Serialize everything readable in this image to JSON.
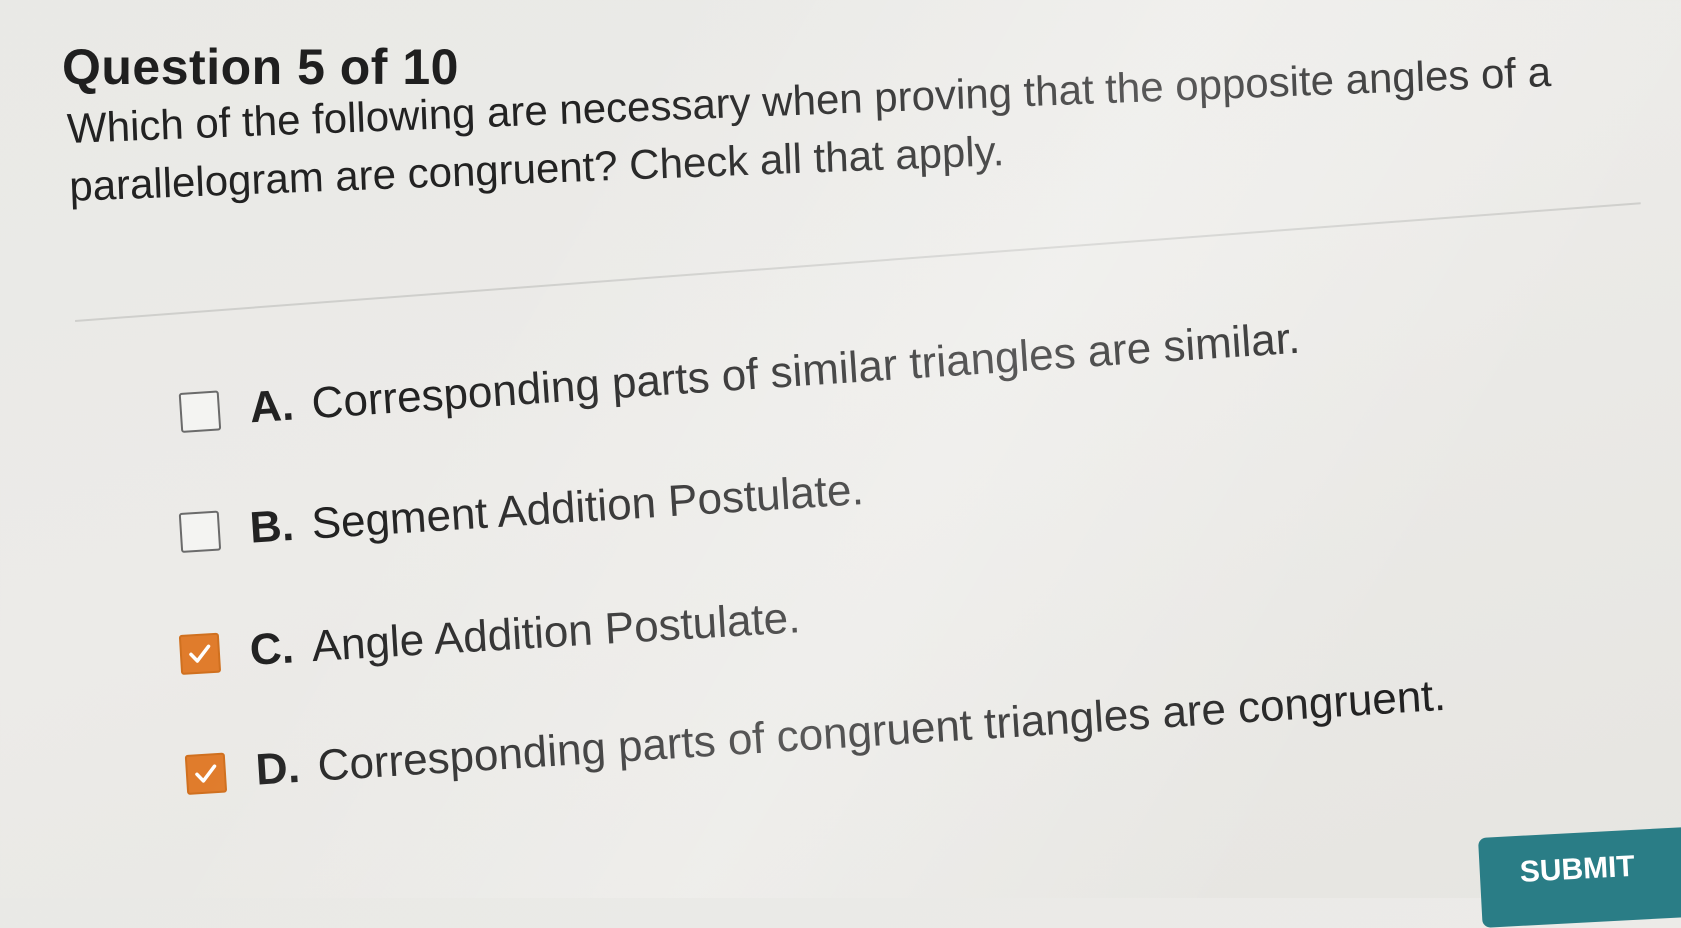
{
  "quiz": {
    "header": "Question 5 of 10",
    "prompt": "Which of the following are necessary when proving that the opposite angles of a parallelogram are congruent? Check all that apply.",
    "choices": [
      {
        "letter": "A.",
        "text": "Corresponding parts of similar triangles are similar.",
        "checked": false
      },
      {
        "letter": "B.",
        "text": "Segment Addition Postulate.",
        "checked": false
      },
      {
        "letter": "C.",
        "text": "Angle Addition Postulate.",
        "checked": true
      },
      {
        "letter": "D.",
        "text": "Corresponding parts of congruent triangles are congruent.",
        "checked": true
      }
    ],
    "submit_label": "SUBMIT"
  },
  "colors": {
    "checked_fill": "#e07c2c",
    "button_fill": "#2a7d86"
  },
  "icons": {
    "checkmark": "check-icon"
  }
}
